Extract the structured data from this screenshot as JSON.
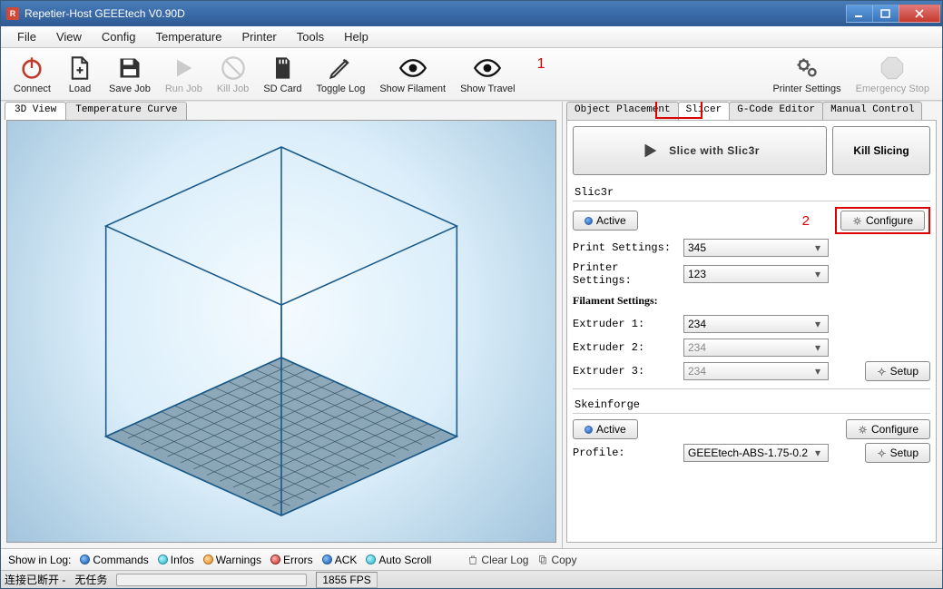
{
  "window": {
    "title": "Repetier-Host GEEEtech V0.90D"
  },
  "menu": {
    "items": [
      "File",
      "View",
      "Config",
      "Temperature",
      "Printer",
      "Tools",
      "Help"
    ]
  },
  "toolbar": {
    "connect": "Connect",
    "load": "Load",
    "save_job": "Save Job",
    "run_job": "Run Job",
    "kill_job": "Kill Job",
    "sd_card": "SD Card",
    "toggle_log": "Toggle Log",
    "show_filament": "Show Filament",
    "show_travel": "Show Travel",
    "printer_settings": "Printer Settings",
    "emergency_stop": "Emergency Stop"
  },
  "annotations": {
    "one": "1",
    "two": "2"
  },
  "left_tabs": {
    "view3d": "3D View",
    "temp_curve": "Temperature Curve"
  },
  "right_tabs": {
    "obj_place": "Object Placement",
    "slicer": "Slicer",
    "gcode": "G-Code Editor",
    "manual": "Manual Control"
  },
  "slicer": {
    "slice_btn": "Slice with Slic3r",
    "kill_btn": "Kill Slicing",
    "slic3r_head": "Slic3r",
    "active_btn": "Active",
    "configure_btn": "Configure",
    "setup_btn": "Setup",
    "print_settings_lbl": "Print Settings:",
    "printer_settings_lbl": "Printer Settings:",
    "filament_head": "Filament Settings:",
    "ext1_lbl": "Extruder 1:",
    "ext2_lbl": "Extruder 2:",
    "ext3_lbl": "Extruder 3:",
    "print_settings_val": "345",
    "printer_settings_val": "123",
    "ext1_val": "234",
    "ext2_val": "234",
    "ext3_val": "234",
    "skein_head": "Skeinforge",
    "profile_lbl": "Profile:",
    "profile_val": "GEEEtech-ABS-1.75-0.2"
  },
  "logbar": {
    "show_in_log": "Show in Log:",
    "commands": "Commands",
    "infos": "Infos",
    "warnings": "Warnings",
    "errors": "Errors",
    "ack": "ACK",
    "auto_scroll": "Auto Scroll",
    "clear_log": "Clear Log",
    "copy": "Copy"
  },
  "status": {
    "conn": "连接已断开 -",
    "task": "无任务",
    "fps": "1855 FPS"
  }
}
